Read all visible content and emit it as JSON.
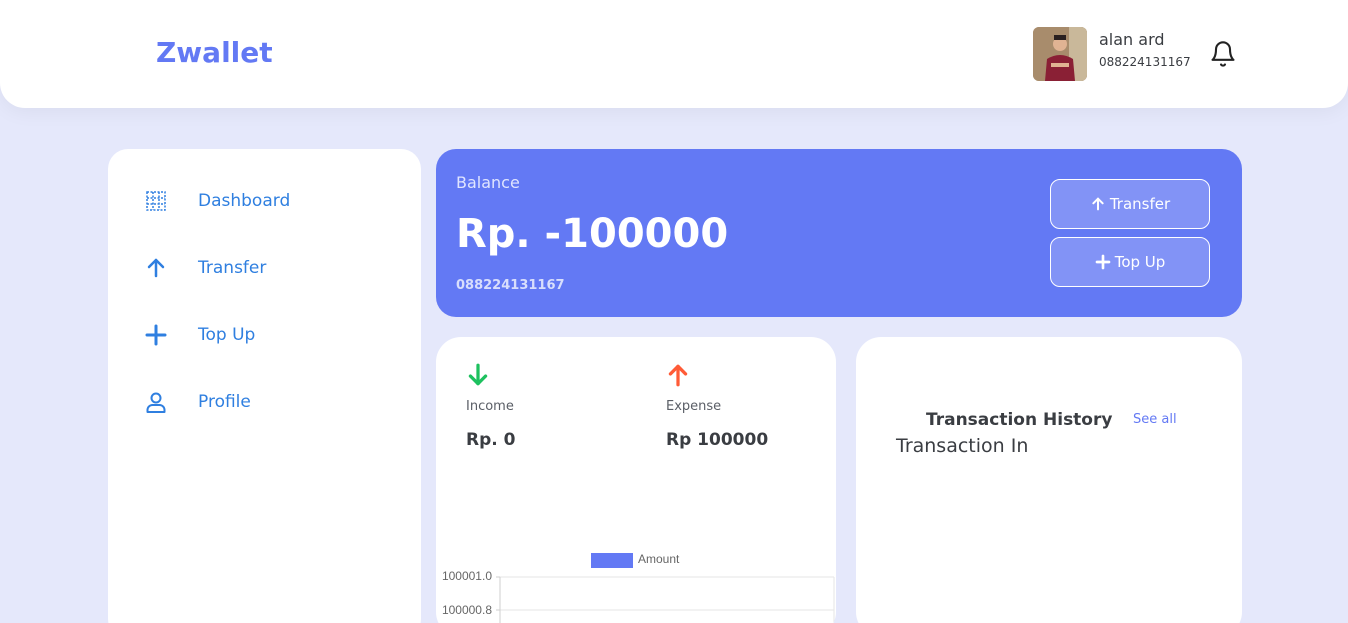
{
  "header": {
    "brand": "Zwallet",
    "user": {
      "name": "alan ard",
      "phone": "088224131167"
    }
  },
  "sidebar": {
    "items": [
      {
        "label": "Dashboard",
        "icon": "grid-icon"
      },
      {
        "label": "Transfer",
        "icon": "arrow-up-icon"
      },
      {
        "label": "Top Up",
        "icon": "plus-icon"
      },
      {
        "label": "Profile",
        "icon": "user-icon"
      }
    ]
  },
  "balance": {
    "label": "Balance",
    "amount": "Rp. -100000",
    "phone": "088224131167",
    "transfer_label": "Transfer",
    "topup_label": "Top Up"
  },
  "stats": {
    "income_label": "Income",
    "income_value": "Rp. 0",
    "expense_label": "Expense",
    "expense_value": "Rp 100000",
    "colors": {
      "income": "#1ec15f",
      "expense": "#ff5b37"
    }
  },
  "chart_data": {
    "type": "bar",
    "series": [
      {
        "name": "Amount",
        "values": []
      }
    ],
    "y_ticks": [
      "100001.0",
      "100000.8"
    ],
    "legend": "top",
    "color": "#6379f4"
  },
  "history": {
    "title": "Transaction History",
    "see_all": "See all",
    "section": "Transaction In"
  },
  "colors": {
    "accent": "#6379f4",
    "background": "#e5e8fb",
    "link": "#2f7fe0"
  }
}
